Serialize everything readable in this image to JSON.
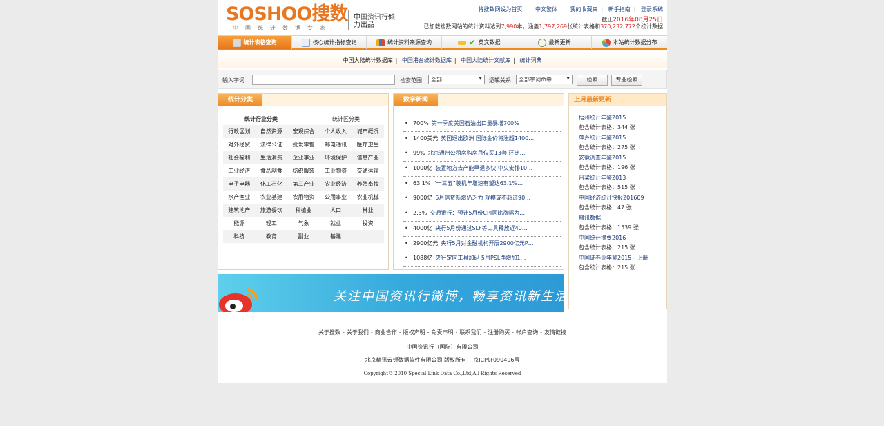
{
  "header": {
    "brand": "SOSHOO搜数",
    "slogan": "中国统计数据专家",
    "partner": "中国资讯行倾力出品",
    "toplinks": [
      "将搜数网设为首页",
      "中文繁体",
      "我的收藏夹",
      "新手指南",
      "登录系统"
    ],
    "date_prefix": "截止",
    "date_value": "2016年08月25日",
    "stat_prefix": "已加载搜数网站的统计资料达到",
    "stat_books": "7,990",
    "stat_mid1": "本，涵盖",
    "stat_tables": "1,797,269",
    "stat_mid2": "张统计表格和",
    "stat_data": "370,232,772",
    "stat_suffix": "个统计数据"
  },
  "nav": {
    "items": [
      {
        "label": "统计表格查询",
        "icon_color": "#d9d9d9"
      },
      {
        "label": "核心统计指标查询",
        "icon_color": "#c9d6e8"
      },
      {
        "label": "统计资料来源查询",
        "icon_color": "#8fb0e0"
      },
      {
        "label": "英文数据",
        "icon_color": "#f2c12e"
      },
      {
        "label": "最新更新",
        "icon_color": "#f4f0d5"
      },
      {
        "label": "本站统计数据分布",
        "icon_color": "#e97b5a"
      }
    ],
    "sublinks": [
      "中国大陆统计数据库",
      "中国港台统计数据库",
      "中国大陆统计文献库",
      "统计词典"
    ]
  },
  "search": {
    "keyword_label": "输入字词",
    "keyword_value": "",
    "scope_label": "检索范围",
    "scope_value": "全部",
    "logic_label": "逻辑关系",
    "logic_value": "全部字词命中",
    "search_button": "检索",
    "advanced_button": "专业检索"
  },
  "categories": {
    "tab": "统计分类",
    "industry_title": "统计行业分类",
    "region_title": "统计区分类",
    "rows": [
      [
        "行政区划",
        "自然资源",
        "宏观综合",
        "个人收入",
        "城市概况"
      ],
      [
        "对外经贸",
        "法律公证",
        "批发零售",
        "邮电通讯",
        "医疗卫生"
      ],
      [
        "社会福利",
        "生活消费",
        "企业事业",
        "环境保护",
        "信息产业"
      ],
      [
        "工业经济",
        "食品副食",
        "纺织服装",
        "工业物资",
        "交通运输"
      ],
      [
        "电子电器",
        "化工石化",
        "第三产业",
        "农业经济",
        "养殖畜牧"
      ],
      [
        "水产渔业",
        "农业基建",
        "农用物资",
        "公用事业",
        "农业机械"
      ],
      [
        "建筑地产",
        "旅游餐饮",
        "种植业",
        "人口",
        "林业"
      ],
      [
        "能源",
        "轻工",
        "气象",
        "就业",
        "投资"
      ],
      [
        "科技",
        "教育",
        "副业",
        "基建",
        ""
      ]
    ]
  },
  "news": {
    "tab": "数字新闻",
    "items": [
      {
        "num": "700%",
        "text": "第一季度美国石油出口量暴增700%"
      },
      {
        "num": "1400美元",
        "text": "英国退出欧洲 国际金价将涨超1400…"
      },
      {
        "num": "99%",
        "text": "北京通州公租房购房月仅买13套 环比…"
      },
      {
        "num": "1000亿",
        "text": "装置地方去产能早退多快 中央安排10…"
      },
      {
        "num": "63.1%",
        "text": "“十三五”装机年增速有望达63.1%…"
      },
      {
        "num": "9000亿",
        "text": "5月信贷新增仍乏力 规模或不超过90…"
      },
      {
        "num": "2.3%",
        "text": "交通银行：预计5月份CPI同比涨幅为…"
      },
      {
        "num": "4000亿",
        "text": "央行5月份通过SLF等工具释放近40…"
      },
      {
        "num": "2900亿元",
        "text": "央行5月对金融机构开展2900亿元P…"
      },
      {
        "num": "1088亿",
        "text": "央行定向工具加码 5月PSL净增加1…"
      }
    ]
  },
  "latest": {
    "title": "上月最新更新",
    "items": [
      {
        "title": "梧州统计年鉴2015",
        "count": "包含统计表格：344 张"
      },
      {
        "title": "萍乡统计年鉴2015",
        "count": "包含统计表格：275 张"
      },
      {
        "title": "安徽调查年鉴2015",
        "count": "包含统计表格：196 张"
      },
      {
        "title": "吕梁统计年鉴2013",
        "count": "包含统计表格：515 张"
      },
      {
        "title": "中国经济统计快报201609",
        "count": "包含统计表格：47 张"
      },
      {
        "title": "粮讯数据",
        "count": "包含统计表格：1539 张"
      },
      {
        "title": "中国统计摘要2016",
        "count": "包含统计表格：215 张"
      },
      {
        "title": "中国证券业年鉴2015 - 上册",
        "count": "包含统计表格：215 张"
      }
    ]
  },
  "banner": {
    "text": "关注中国资讯行微博，畅享资讯新生活！"
  },
  "footer": {
    "links": [
      "关于搜数",
      "关于我们",
      "商业合作",
      "版权声明",
      "免责声明",
      "联系我们",
      "注册购买",
      "帐户查询",
      "友情链接"
    ],
    "company": "中国资讯行（国际）有限公司",
    "owner": "北京精讯云顿数据软件有限公司 版权所有",
    "icp": "京ICP证090496号",
    "copyright": "Copyright© 2010 Special Link Data Co.,Ltd,All Rights Reserved"
  }
}
